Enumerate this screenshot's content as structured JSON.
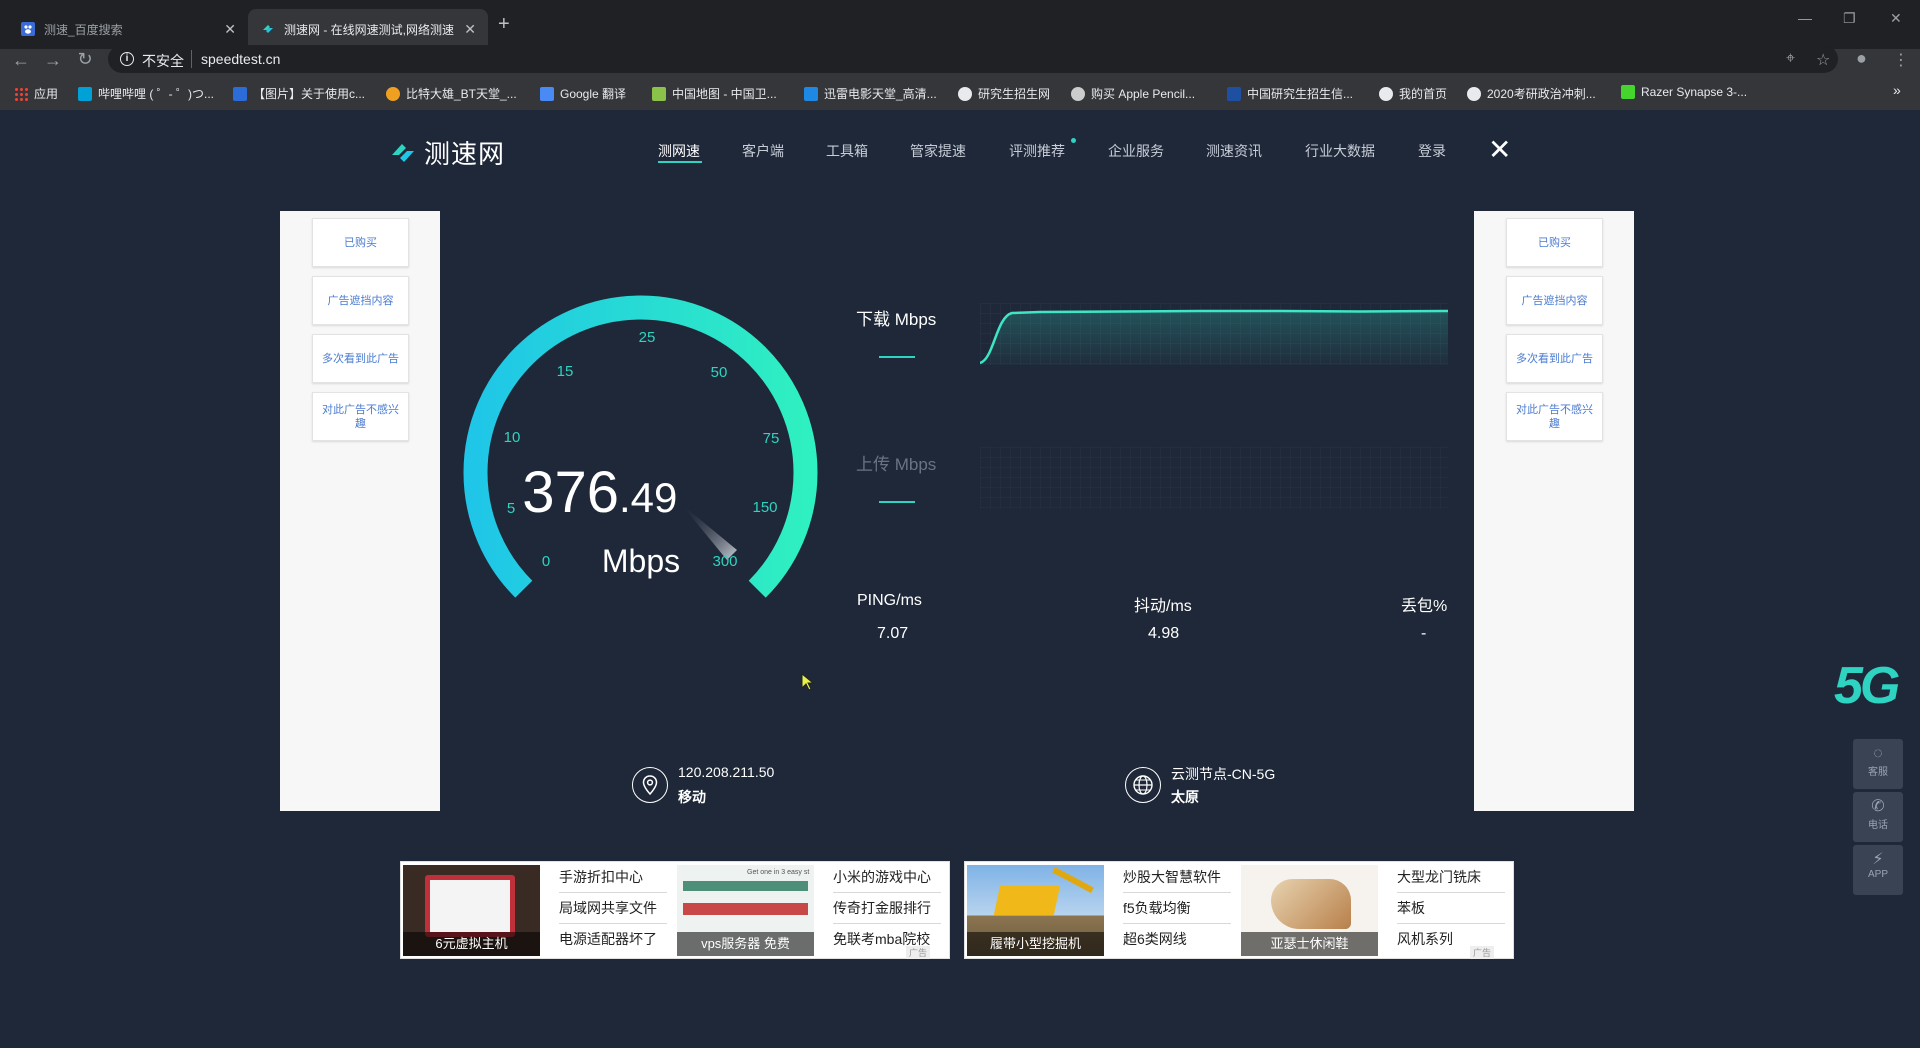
{
  "browser": {
    "tabs": [
      {
        "title": "测速_百度搜索",
        "active": false
      },
      {
        "title": "测速网 - 在线网速测试,网络测速",
        "active": true
      }
    ],
    "window_controls": [
      "—",
      "❐",
      "✕"
    ],
    "address": {
      "security": "不安全",
      "url": "speedtest.cn"
    },
    "bookmarks": [
      {
        "label": "应用",
        "color": "#e8eaed"
      },
      {
        "label": "哔哩哔哩 ( ゜- ゜)つ...",
        "color": "#00a1d6"
      },
      {
        "label": "【图片】关于使用c...",
        "color": "#2b6cd8"
      },
      {
        "label": "比特大雄_BT天堂_...",
        "color": "#f0a020"
      },
      {
        "label": "Google 翻译",
        "color": "#4a8af4"
      },
      {
        "label": "中国地图 - 中国卫...",
        "color": "#8bc34a"
      },
      {
        "label": "迅雷电影天堂_高清...",
        "color": "#1e88e5"
      },
      {
        "label": "研究生招生网",
        "color": "#e8eaed"
      },
      {
        "label": "购买 Apple Pencil...",
        "color": "#cccccc"
      },
      {
        "label": "中国研究生招生信...",
        "color": "#1e4fa0"
      },
      {
        "label": "我的首页",
        "color": "#e8eaed"
      },
      {
        "label": "2020考研政治冲刺...",
        "color": "#e8eaed"
      },
      {
        "label": "Razer Synapse 3-...",
        "color": "#44d62c"
      }
    ],
    "overflow": "»"
  },
  "site": {
    "logo": "测速网",
    "nav": [
      "测网速",
      "客户端",
      "工具箱",
      "管家提速",
      "评测推荐",
      "企业服务",
      "测速资讯",
      "行业大数据",
      "登录"
    ],
    "close": "✕"
  },
  "ad_panel": {
    "buttons": [
      "已购买",
      "广告遮挡内容",
      "多次看到此广告",
      "对此广告不感兴趣"
    ]
  },
  "gauge": {
    "speed_int": "376",
    "speed_dec": ".49",
    "unit": "Mbps",
    "ticks": [
      "0",
      "5",
      "10",
      "15",
      "25",
      "50",
      "75",
      "150",
      "300"
    ]
  },
  "graphs": {
    "download_label": "下载 Mbps",
    "upload_label": "上传 Mbps"
  },
  "stats": {
    "ping_label": "PING/ms",
    "ping_value": "7.07",
    "jitter_label": "抖动/ms",
    "jitter_value": "4.98",
    "loss_label": "丢包%",
    "loss_value": "-"
  },
  "location": {
    "ip": "120.208.211.50",
    "isp": "移动",
    "node": "云测节点-CN-5G",
    "city": "太原"
  },
  "side": {
    "badge": "5G",
    "buttons": [
      {
        "label": "客服",
        "icon": "chat-icon"
      },
      {
        "label": "电话",
        "icon": "phone-icon"
      },
      {
        "label": "APP",
        "icon": "app-icon"
      }
    ]
  },
  "ads": {
    "left": {
      "cards": [
        {
          "caption": "6元虚拟主机",
          "links": [
            "手游折扣中心",
            "局域网共享文件",
            "电源适配器坏了"
          ]
        },
        {
          "caption": "vps服务器 免费",
          "thumb_text": "Get one in 3 easy st",
          "links": [
            "小米的游戏中心",
            "传奇打金服排行",
            "免联考mba院校"
          ]
        }
      ]
    },
    "right": {
      "cards": [
        {
          "caption": "履带小型挖掘机",
          "links": [
            "炒股大智慧软件",
            "f5负载均衡",
            "超6类网线"
          ]
        },
        {
          "caption": "亚瑟士休闲鞋",
          "links": [
            "大型龙门铣床",
            "苯板",
            "风机系列"
          ]
        }
      ]
    },
    "mark": "广告"
  },
  "colors": {
    "accent": "#2fd3c1",
    "background": "#1f2838",
    "gauge_start": "#1fc6e8",
    "gauge_end": "#2ff0c0"
  }
}
